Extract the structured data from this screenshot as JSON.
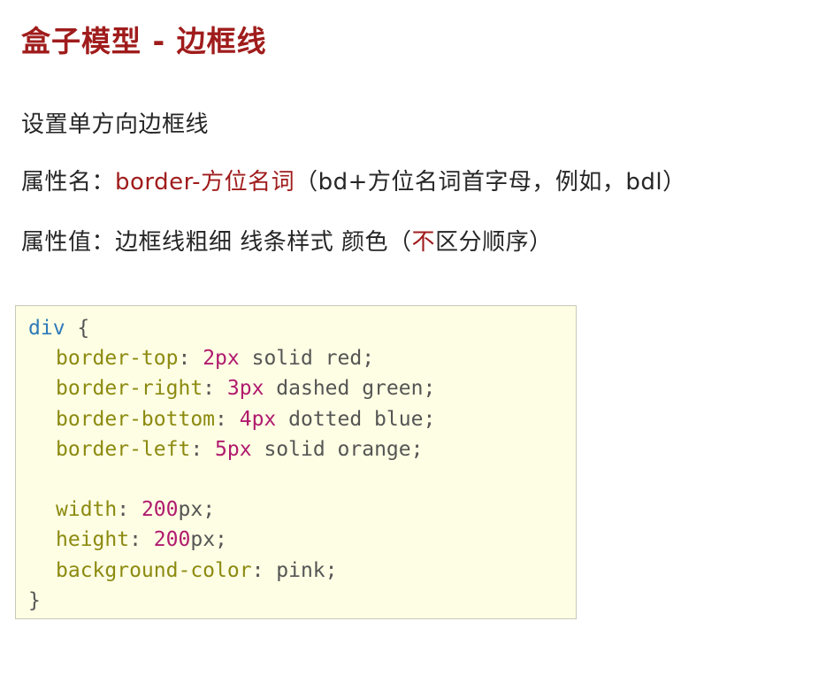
{
  "title": "盒子模型 - 边框线",
  "intro": "设置单方向边框线",
  "prop_name": {
    "label": "属性名：",
    "keyword": "border-方位名词",
    "note": "（bd+方位名词首字母，例如，bdl）"
  },
  "prop_value": {
    "label": "属性值：",
    "text_before": "边框线粗细  线条样式  颜色（",
    "highlight": "不",
    "text_after": "区分顺序）"
  },
  "code": {
    "selector": "div",
    "open_brace": "{",
    "close_brace": "}",
    "rules": [
      {
        "prop": "border-top",
        "num": "2",
        "unit": "px",
        "rest": " solid red;"
      },
      {
        "prop": "border-right",
        "num": "3",
        "unit": "px",
        "rest": " dashed green;"
      },
      {
        "prop": "border-bottom",
        "num": "4",
        "unit": "px",
        "rest": " dotted blue;"
      },
      {
        "prop": "border-left",
        "num": "5",
        "unit": "px",
        "rest": " solid orange;"
      },
      {
        "prop": "width",
        "num": "200",
        "unit": "px",
        "rest": ";"
      },
      {
        "prop": "height",
        "num": "200",
        "unit": "px",
        "rest": ";"
      },
      {
        "prop": "background-color",
        "num": "",
        "unit": "",
        "rest": "pink;"
      }
    ],
    "colon": ": "
  },
  "colors": {
    "accent": "#a01c1c",
    "code_background": "#fefee4",
    "selector": "#2f7ab8",
    "property": "#8c8a10",
    "number": "#b01a6e"
  }
}
